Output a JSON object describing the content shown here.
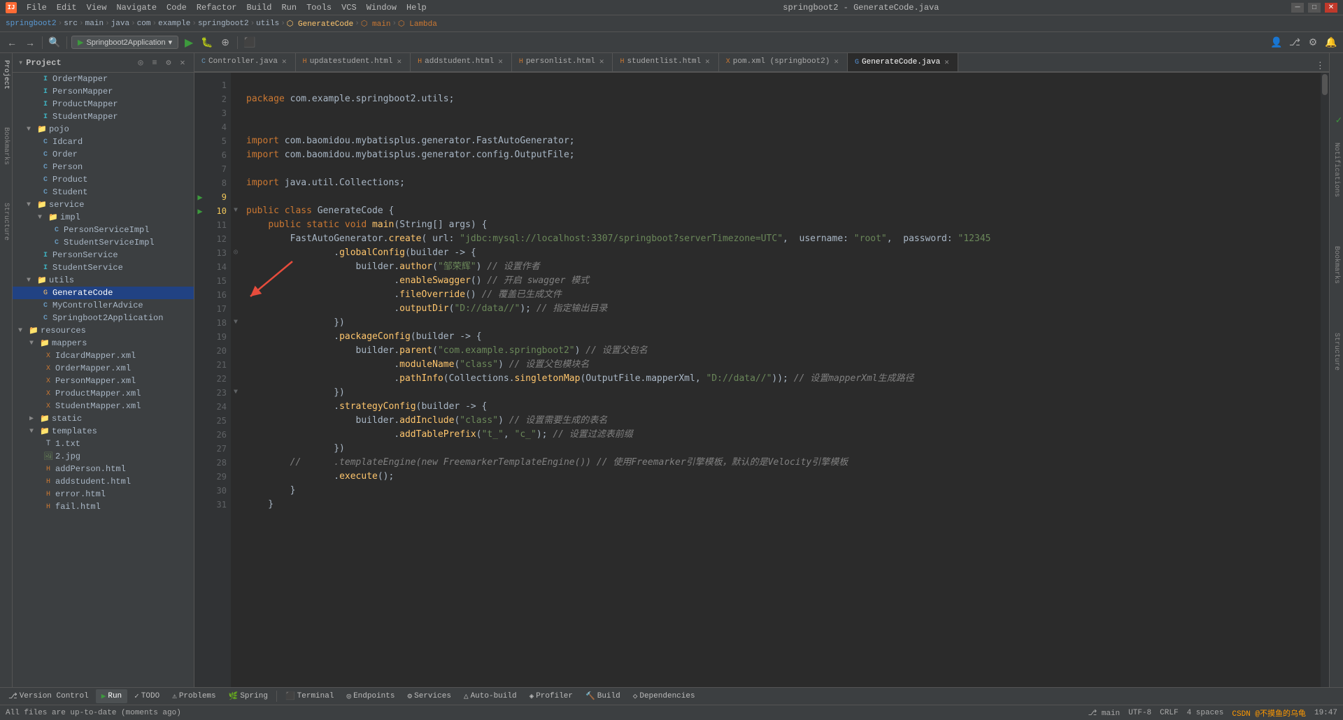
{
  "app": {
    "title": "springboot2 - GenerateCode.java",
    "logo": "IJ"
  },
  "menubar": {
    "items": [
      "File",
      "Edit",
      "View",
      "Navigate",
      "Code",
      "Refactor",
      "Build",
      "Run",
      "Tools",
      "VCS",
      "Window",
      "Help"
    ]
  },
  "breadcrumb": {
    "items": [
      "springboot2",
      "src",
      "main",
      "java",
      "com",
      "example",
      "springboot2",
      "utils",
      "GenerateCode",
      "main",
      "Lambda"
    ]
  },
  "tabs": [
    {
      "label": "Controller.java",
      "type": "java",
      "active": false
    },
    {
      "label": "updatestudent.html",
      "type": "html",
      "active": false
    },
    {
      "label": "addstudent.html",
      "type": "html",
      "active": false
    },
    {
      "label": "personlist.html",
      "type": "html",
      "active": false
    },
    {
      "label": "studentlist.html",
      "type": "html",
      "active": false
    },
    {
      "label": "pom.xml (springboot2)",
      "type": "xml",
      "active": false
    },
    {
      "label": "GenerateCode.java",
      "type": "java",
      "active": true
    }
  ],
  "sidebar": {
    "title": "Project",
    "tree": [
      {
        "level": 0,
        "type": "interface",
        "label": "OrderMapper",
        "indent": 40
      },
      {
        "level": 0,
        "type": "interface",
        "label": "PersonMapper",
        "indent": 40
      },
      {
        "level": 0,
        "type": "interface",
        "label": "ProductMapper",
        "indent": 40
      },
      {
        "level": 0,
        "type": "interface",
        "label": "StudentMapper",
        "indent": 40
      },
      {
        "level": 0,
        "type": "folder-open",
        "label": "pojo",
        "indent": 24
      },
      {
        "level": 1,
        "type": "class",
        "label": "Idcard",
        "indent": 40
      },
      {
        "level": 1,
        "type": "class",
        "label": "Order",
        "indent": 40
      },
      {
        "level": 1,
        "type": "class",
        "label": "Person",
        "indent": 40
      },
      {
        "level": 1,
        "type": "class",
        "label": "Product",
        "indent": 40
      },
      {
        "level": 1,
        "type": "class",
        "label": "Student",
        "indent": 40
      },
      {
        "level": 0,
        "type": "folder-open",
        "label": "service",
        "indent": 24
      },
      {
        "level": 1,
        "type": "folder-open",
        "label": "impl",
        "indent": 40
      },
      {
        "level": 2,
        "type": "class",
        "label": "PersonServiceImpl",
        "indent": 56
      },
      {
        "level": 2,
        "type": "class",
        "label": "StudentServiceImpl",
        "indent": 56
      },
      {
        "level": 1,
        "type": "interface",
        "label": "PersonService",
        "indent": 40
      },
      {
        "level": 1,
        "type": "interface",
        "label": "StudentService",
        "indent": 40
      },
      {
        "level": 0,
        "type": "folder-open",
        "label": "utils",
        "indent": 24
      },
      {
        "level": 1,
        "type": "class-active",
        "label": "GenerateCode",
        "indent": 40
      },
      {
        "level": 1,
        "type": "class",
        "label": "MyControllerAdvice",
        "indent": 40
      },
      {
        "level": 1,
        "type": "class",
        "label": "Springboot2Application",
        "indent": 40
      },
      {
        "level": 0,
        "type": "folder-open",
        "label": "resources",
        "indent": 12
      },
      {
        "level": 1,
        "type": "folder-open",
        "label": "mappers",
        "indent": 28
      },
      {
        "level": 2,
        "type": "xml",
        "label": "IdcardMapper.xml",
        "indent": 44
      },
      {
        "level": 2,
        "type": "xml",
        "label": "OrderMapper.xml",
        "indent": 44
      },
      {
        "level": 2,
        "type": "xml",
        "label": "PersonMapper.xml",
        "indent": 44
      },
      {
        "level": 2,
        "type": "xml",
        "label": "ProductMapper.xml",
        "indent": 44
      },
      {
        "level": 2,
        "type": "xml",
        "label": "StudentMapper.xml",
        "indent": 44
      },
      {
        "level": 1,
        "type": "folder",
        "label": "static",
        "indent": 28
      },
      {
        "level": 1,
        "type": "folder-open",
        "label": "templates",
        "indent": 28
      },
      {
        "level": 2,
        "type": "txt",
        "label": "1.txt",
        "indent": 44
      },
      {
        "level": 2,
        "type": "img",
        "label": "2.jpg",
        "indent": 44
      },
      {
        "level": 2,
        "type": "html",
        "label": "addPerson.html",
        "indent": 44
      },
      {
        "level": 2,
        "type": "html",
        "label": "addstudent.html",
        "indent": 44
      },
      {
        "level": 2,
        "type": "html",
        "label": "error.html",
        "indent": 44
      },
      {
        "level": 2,
        "type": "html",
        "label": "fail.html",
        "indent": 44
      }
    ]
  },
  "code": {
    "filename": "GenerateCode.java",
    "lines": [
      {
        "num": 1,
        "content": "package com.example.springboot2.utils;"
      },
      {
        "num": 2,
        "content": ""
      },
      {
        "num": 3,
        "content": ""
      },
      {
        "num": 4,
        "content": "import com.baomidou.mybatisplus.generator.FastAutoGenerator;"
      },
      {
        "num": 5,
        "content": "import com.baomidou.mybatisplus.generator.config.OutputFile;"
      },
      {
        "num": 6,
        "content": ""
      },
      {
        "num": 7,
        "content": "import java.util.Collections;"
      },
      {
        "num": 8,
        "content": ""
      },
      {
        "num": 9,
        "content": "public class GenerateCode {"
      },
      {
        "num": 10,
        "content": "    public static void main(String[] args) {"
      },
      {
        "num": 11,
        "content": "        FastAutoGenerator.create( url: \"jdbc:mysql://localhost:3307/springboot?serverTimezone=UTC\",  username: \"root\",  password: \"12345"
      },
      {
        "num": 12,
        "content": "                .globalConfig(builder -> {"
      },
      {
        "num": 13,
        "content": "                    builder.author(\"邹荣辉\") // 设置作者"
      },
      {
        "num": 14,
        "content": "                           .enableSwagger() // 开启 swagger 模式"
      },
      {
        "num": 15,
        "content": "                           .fileOverride() // 覆盖已生成文件"
      },
      {
        "num": 16,
        "content": "                           .outputDir(\"D://data//\"); // 指定输出目录"
      },
      {
        "num": 17,
        "content": "                })"
      },
      {
        "num": 18,
        "content": "                .packageConfig(builder -> {"
      },
      {
        "num": 19,
        "content": "                    builder.parent(\"com.example.springboot2\") // 设置父包名"
      },
      {
        "num": 20,
        "content": "                           .moduleName(\"class\") // 设置父包模块名"
      },
      {
        "num": 21,
        "content": "                           .pathInfo(Collections.singletonMap(OutputFile.mapperXml, \"D://data//\")); // 设置mapperXml生成路径"
      },
      {
        "num": 22,
        "content": "                })"
      },
      {
        "num": 23,
        "content": "                .strategyConfig(builder -> {"
      },
      {
        "num": 24,
        "content": "                    builder.addInclude(\"class\") // 设置需要生成的表名"
      },
      {
        "num": 25,
        "content": "                           .addTablePrefix(\"t_\", \"c_\"); // 设置过滤表前缀"
      },
      {
        "num": 26,
        "content": "                })"
      },
      {
        "num": 27,
        "content": "        //      .templateEngine(new FreemarkerTemplateEngine()) // 使用Freemarker引擎模板，默认的是Velocity引擎模板"
      },
      {
        "num": 28,
        "content": "                .execute();"
      },
      {
        "num": 29,
        "content": "        }"
      },
      {
        "num": 30,
        "content": "    }"
      },
      {
        "num": 31,
        "content": ""
      }
    ]
  },
  "bottom_toolbar": {
    "items": [
      {
        "label": "Version Control",
        "icon": "⎇"
      },
      {
        "label": "Run",
        "icon": "▶",
        "active": true
      },
      {
        "label": "TODO",
        "icon": "✓"
      },
      {
        "label": "Problems",
        "icon": "⚠"
      },
      {
        "label": "Spring",
        "icon": "🌿"
      },
      {
        "label": "Terminal",
        "icon": "⬛"
      },
      {
        "label": "Endpoints",
        "icon": "◎"
      },
      {
        "label": "Services",
        "icon": "⚙"
      },
      {
        "label": "Auto-build",
        "icon": "△"
      },
      {
        "label": "Profiler",
        "icon": "◈"
      },
      {
        "label": "Build",
        "icon": "🔨"
      },
      {
        "label": "Dependencies",
        "icon": "◇"
      }
    ]
  },
  "statusbar": {
    "left": "All files are up-to-date (moments ago)",
    "right_items": [
      "CRLF",
      "UTF-8",
      "4 spaces",
      "Git: main",
      "19:47"
    ]
  },
  "run_config": "Springboot2Application",
  "right_side_tabs": [
    "Notifications",
    "Bookmarks",
    "Structure"
  ],
  "left_side_tabs": [
    "Project",
    "Bookmarks",
    "Structure"
  ]
}
